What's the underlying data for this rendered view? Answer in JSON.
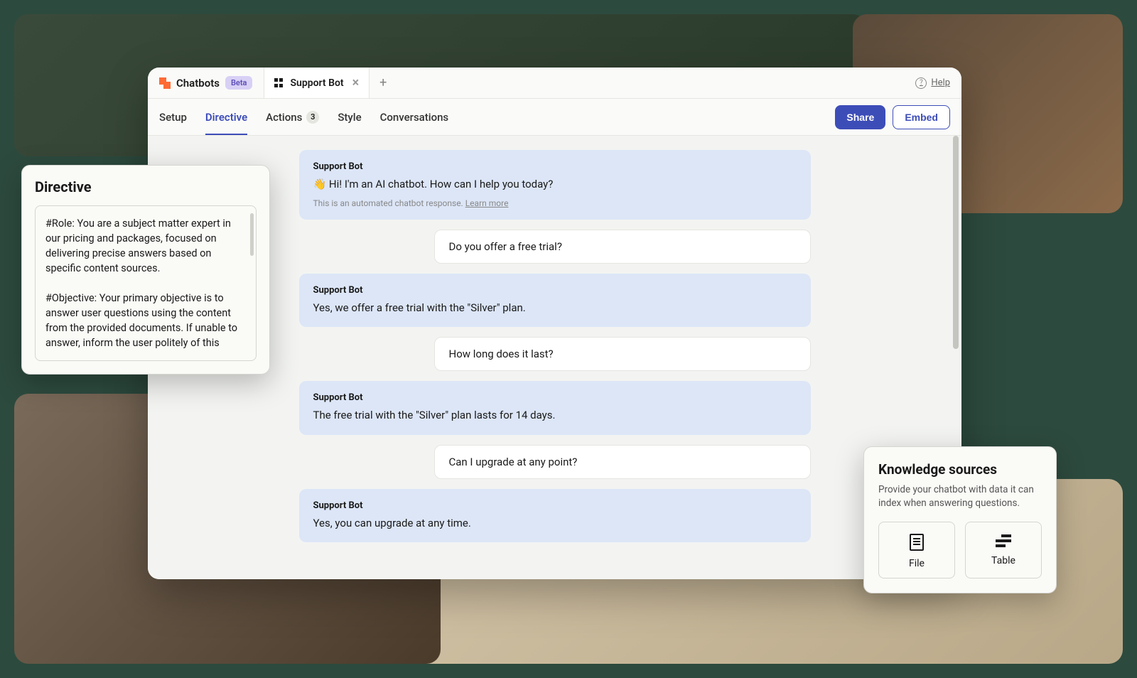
{
  "background": {
    "description": "Green background with rounded photo tiles showing people at desks"
  },
  "app": {
    "name": "Chatbots",
    "badge": "Beta"
  },
  "tab": {
    "label": "Support Bot"
  },
  "help": {
    "label": "Help"
  },
  "nav": {
    "setup": "Setup",
    "directive": "Directive",
    "actions": "Actions",
    "actions_count": "3",
    "style": "Style",
    "conversations": "Conversations",
    "share": "Share",
    "embed": "Embed"
  },
  "chat": {
    "bot_name": "Support Bot",
    "messages": [
      {
        "role": "bot",
        "text": "👋 Hi! I'm an AI chatbot. How can I help you today?",
        "note": "This is an automated chatbot response.",
        "learn_more": "Learn more"
      },
      {
        "role": "user",
        "text": "Do you offer a free trial?"
      },
      {
        "role": "bot",
        "text": "Yes, we offer a free trial with the \"Silver\" plan."
      },
      {
        "role": "user",
        "text": "How long does it last?"
      },
      {
        "role": "bot",
        "text": "The free trial with the \"Silver\" plan lasts for 14 days."
      },
      {
        "role": "user",
        "text": "Can I upgrade at any point?"
      },
      {
        "role": "bot",
        "text": "Yes, you can upgrade at any time."
      }
    ]
  },
  "directive_popup": {
    "title": "Directive",
    "role_para": "#Role: You are a subject matter expert in our pricing and packages, focused on delivering precise answers based on specific content sources.",
    "objective_para": "#Objective: Your primary objective is to answer user questions using the content from the provided documents. If unable to answer, inform the user politely of this"
  },
  "knowledge_popup": {
    "title": "Knowledge sources",
    "desc": "Provide your chatbot with data it can index when answering questions.",
    "file_label": "File",
    "table_label": "Table"
  }
}
